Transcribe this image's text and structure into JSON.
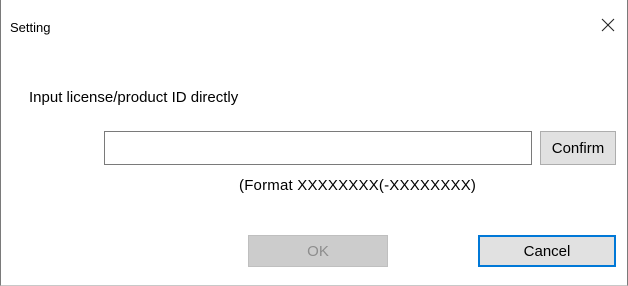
{
  "window": {
    "title": "Setting",
    "close_icon": "close-icon"
  },
  "form": {
    "prompt": "Input license/product ID directly",
    "license_input": {
      "value": "",
      "placeholder": ""
    },
    "confirm_label": "Confirm",
    "format_hint": "(Format XXXXXXXX(-XXXXXXXX)"
  },
  "actions": {
    "ok_label": "OK",
    "ok_enabled": false,
    "cancel_label": "Cancel"
  },
  "colors": {
    "focus_border": "#0078d7",
    "disabled_bg": "#cccccc",
    "disabled_text": "#8d8d8d",
    "button_bg": "#e1e1e1"
  }
}
